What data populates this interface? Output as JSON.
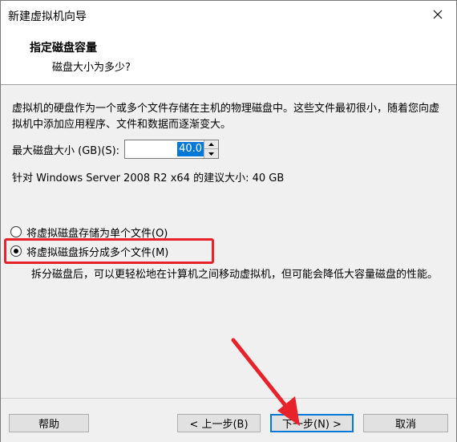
{
  "window": {
    "title": "新建虚拟机向导"
  },
  "header": {
    "title": "指定磁盘容量",
    "subtitle": "磁盘大小为多少?"
  },
  "body": {
    "description": "虚拟机的硬盘作为一个或多个文件存储在主机的物理磁盘中。这些文件最初很小，随着您向虚拟机中添加应用程序、文件和数据而逐渐变大。",
    "max_size_label": "最大磁盘大小 (GB)(S):",
    "max_size_value": "40.0",
    "recommend": "针对 Windows Server 2008 R2 x64 的建议大小: 40 GB",
    "option_single": "将虚拟磁盘存储为单个文件(O)",
    "option_split": "将虚拟磁盘拆分成多个文件(M)",
    "split_description": "拆分磁盘后，可以更轻松地在计算机之间移动虚拟机，但可能会降低大容量磁盘的性能。"
  },
  "footer": {
    "help": "帮助",
    "back": "< 上一步(B)",
    "next": "下一步(N) >",
    "cancel": "取消"
  },
  "colors": {
    "highlight": "#e8222a",
    "selection": "#0078d7"
  }
}
